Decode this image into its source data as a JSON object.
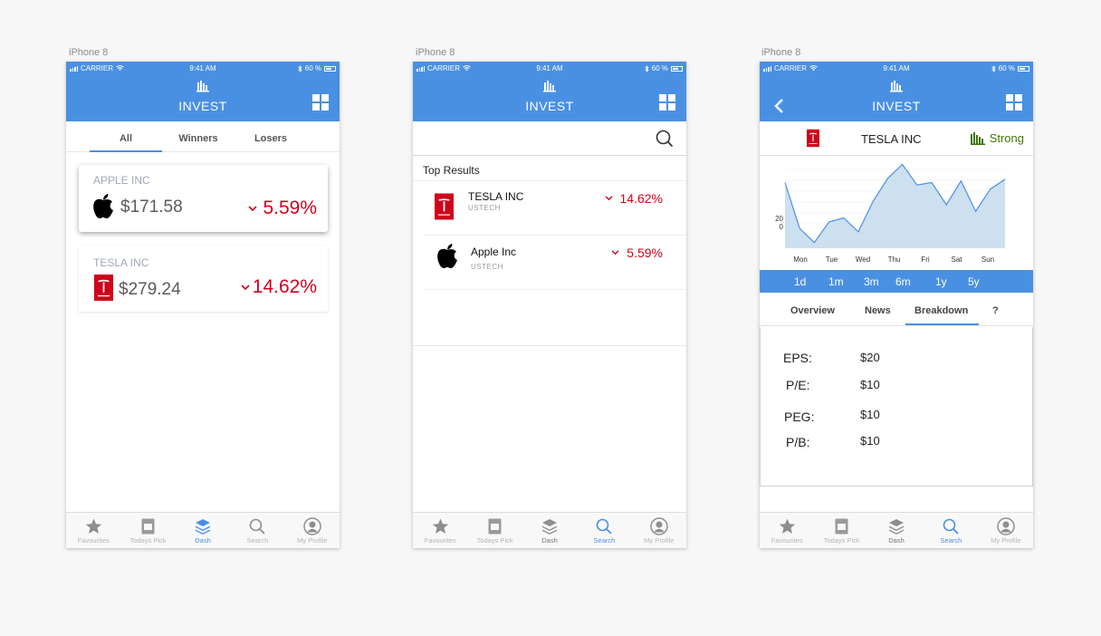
{
  "frames": [
    {
      "label": "iPhone 8"
    },
    {
      "label": "iPhone 8"
    },
    {
      "label": "iPhone 8"
    }
  ],
  "status": {
    "carrier": "CARRIER",
    "time": "9:41 AM",
    "battery": "60 %"
  },
  "app": {
    "title": "INVEST"
  },
  "colors": {
    "accent": "#4a90e2",
    "negative": "#d0021b",
    "positive": "#417505"
  },
  "tabs": [
    {
      "label": "Favourites",
      "icon": "star-icon"
    },
    {
      "label": "Todays Pick",
      "icon": "calendar-icon"
    },
    {
      "label": "Dash",
      "icon": "layers-icon"
    },
    {
      "label": "Search",
      "icon": "search-icon"
    },
    {
      "label": "My Profile",
      "icon": "profile-icon"
    }
  ],
  "screen1": {
    "segments": [
      "All",
      "Winners",
      "Losers"
    ],
    "active_segment": "All",
    "active_tab": "Dash",
    "cards": [
      {
        "name": "APPLE INC",
        "price": "$171.58",
        "change": "5.59%",
        "logo": "apple-logo-icon"
      },
      {
        "name": "TESLA INC",
        "price": "$279.24",
        "change": "14.62%",
        "logo": "tesla-logo-icon"
      }
    ]
  },
  "screen2": {
    "active_tab": "Search",
    "results_title": "Top Results",
    "results": [
      {
        "name": "TESLA INC",
        "exchange": "USTECH",
        "change": "14.62%",
        "logo": "tesla-logo-icon"
      },
      {
        "name": "Apple Inc",
        "exchange": "USTECH",
        "change": "5.59%",
        "logo": "apple-logo-icon"
      }
    ]
  },
  "screen3": {
    "active_tab": "Search",
    "company": "TESLA INC",
    "rating": "Strong",
    "ranges": [
      "1d",
      "1m",
      "3m",
      "6m",
      "1y",
      "5y"
    ],
    "detail_tabs": [
      "Overview",
      "News",
      "Breakdown",
      "?"
    ],
    "active_detail_tab": "Breakdown",
    "metrics": [
      {
        "label": "EPS:",
        "value": "$20"
      },
      {
        "label": "P/E:",
        "value": "$10"
      },
      {
        "label": "PEG:",
        "value": "$10"
      },
      {
        "label": "P/B:",
        "value": "$10"
      }
    ]
  },
  "chart_data": {
    "type": "area",
    "x": [
      "Mon",
      "Tue",
      "Wed",
      "Thu",
      "Fri",
      "Sat",
      "Sun"
    ],
    "y_ticks": [
      "20",
      "0"
    ],
    "series": [
      {
        "values": [
          58,
          2,
          -15,
          10,
          15,
          -2,
          35,
          63,
          80,
          55,
          58,
          31,
          60,
          23,
          50,
          62
        ]
      }
    ],
    "ylim": [
      -22,
      85
    ],
    "grid": true
  }
}
